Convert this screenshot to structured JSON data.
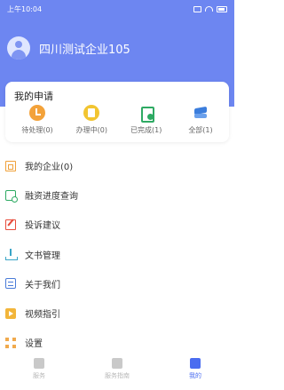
{
  "status_bar": {
    "time": "上午10:04"
  },
  "profile": {
    "company_name": "四川测试企业105"
  },
  "applications": {
    "title": "我的申请",
    "items": [
      {
        "label": "待处理(0)",
        "icon": "clock-icon"
      },
      {
        "label": "办理中(0)",
        "icon": "document-icon"
      },
      {
        "label": "已完成(1)",
        "icon": "check-document-icon"
      },
      {
        "label": "全部(1)",
        "icon": "layers-icon"
      }
    ]
  },
  "menu": {
    "items": [
      {
        "label": "我的企业(0)",
        "icon": "company-icon"
      },
      {
        "label": "融资进度查询",
        "icon": "progress-search-icon"
      },
      {
        "label": "投诉建议",
        "icon": "edit-icon"
      },
      {
        "label": "文书管理",
        "icon": "download-icon"
      },
      {
        "label": "关于我们",
        "icon": "info-card-icon"
      },
      {
        "label": "视频指引",
        "icon": "video-icon"
      },
      {
        "label": "设置",
        "icon": "settings-grid-icon"
      }
    ]
  },
  "tab_bar": {
    "tabs": [
      {
        "label": "服务",
        "active": false
      },
      {
        "label": "服务指南",
        "active": false
      },
      {
        "label": "我的",
        "active": true
      }
    ]
  },
  "colors": {
    "header": "#6d86f1",
    "accent": "#4a6cf0"
  }
}
